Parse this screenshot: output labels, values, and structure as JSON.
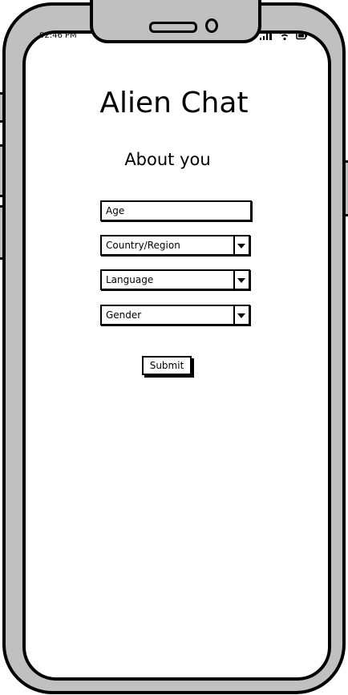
{
  "status_bar": {
    "time": "02:46 PM",
    "icons": [
      "signal-icon",
      "wifi-icon",
      "battery-icon"
    ]
  },
  "app": {
    "title": "Alien Chat",
    "subtitle": "About you"
  },
  "form": {
    "age_placeholder": "Age",
    "country_label": "Country/Region",
    "language_label": "Language",
    "gender_label": "Gender",
    "submit_label": "Submit"
  }
}
